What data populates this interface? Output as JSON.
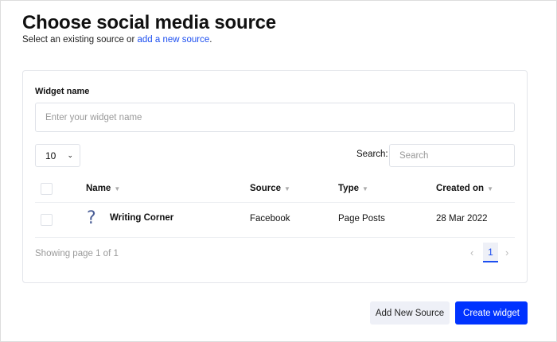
{
  "header": {
    "title": "Choose social media source",
    "subtitle_prefix": "Select an existing source or ",
    "subtitle_link": "add a new source",
    "subtitle_suffix": "."
  },
  "form": {
    "widget_name_label": "Widget name",
    "widget_name_placeholder": "Enter your widget name"
  },
  "table_controls": {
    "page_size": "10",
    "search_label": "Search:",
    "search_placeholder": "Search"
  },
  "table": {
    "columns": [
      "Name",
      "Source",
      "Type",
      "Created on"
    ],
    "rows": [
      {
        "name": "Writing Corner",
        "source": "Facebook",
        "type": "Page Posts",
        "created_on": "28 Mar 2022",
        "icon": "question-icon"
      }
    ]
  },
  "pagination": {
    "info": "Showing page 1 of 1",
    "current_page": "1",
    "prev": "‹",
    "next": "›"
  },
  "footer": {
    "add_source_label": "Add New Source",
    "create_label": "Create widget"
  },
  "colors": {
    "accent": "#0033ff",
    "link": "#1d4ff0"
  }
}
